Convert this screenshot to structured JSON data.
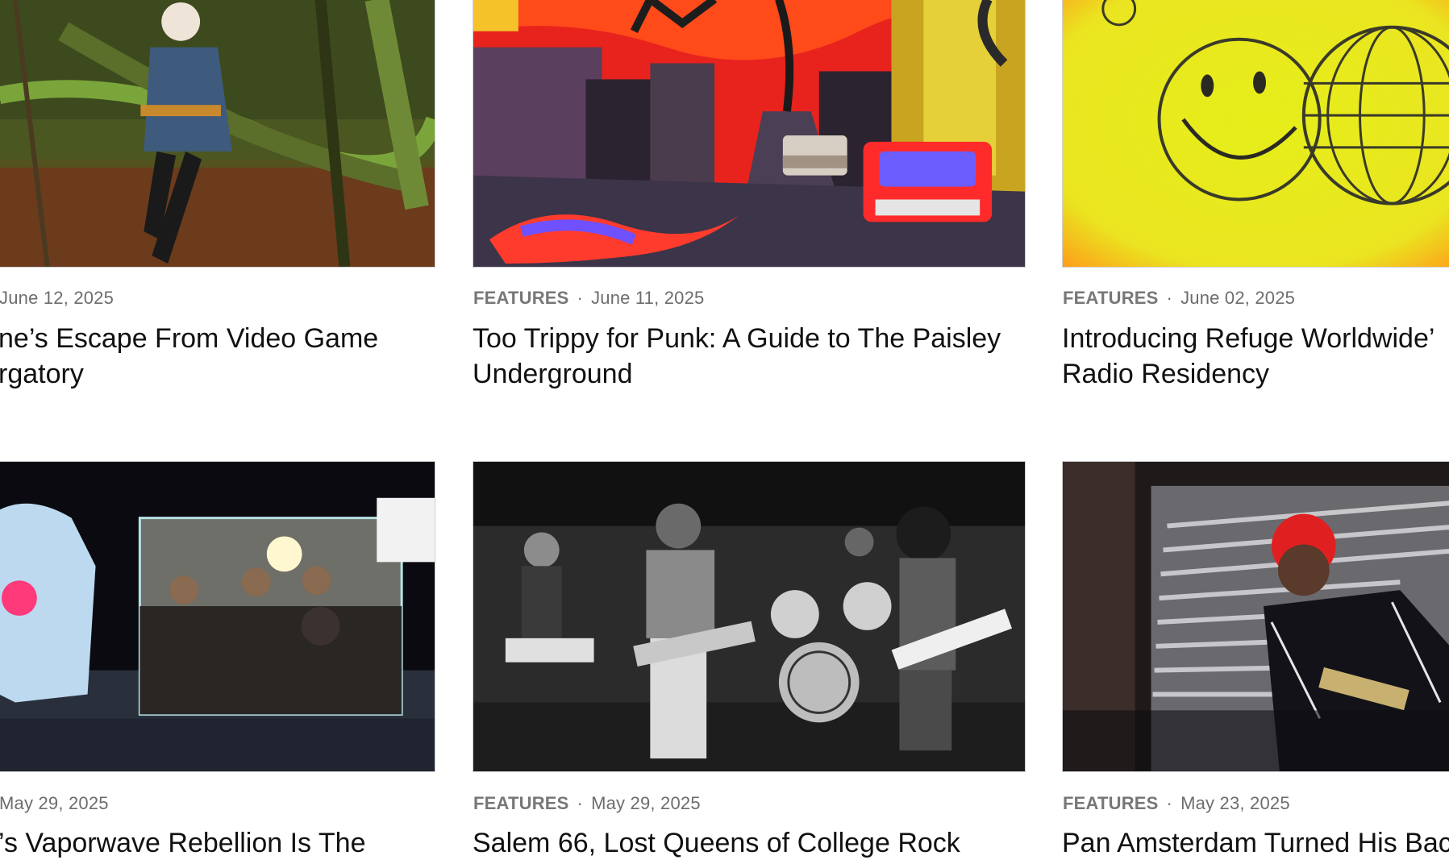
{
  "articles": [
    {
      "category": "",
      "date": "June 12, 2025",
      "title": "ne’s Escape From Video Game\nrgatory",
      "image_icon": "forest-portrait-photo"
    },
    {
      "category": "FEATURES",
      "date": "June 11, 2025",
      "title": "Too Trippy for Punk: A Guide to The Paisley\nUnderground",
      "image_icon": "psychedelic-street-illustration"
    },
    {
      "category": "FEATURES",
      "date": "June 02, 2025",
      "title": "Introducing Refuge Worldwide’\nRadio Residency",
      "image_icon": "smiley-globe-illustration"
    },
    {
      "category": "",
      "date": "May 29, 2025",
      "title": "’s Vaporwave Rebellion Is The",
      "image_icon": "vaporwave-collage-photo"
    },
    {
      "category": "FEATURES",
      "date": "May 29, 2025",
      "title": "Salem 66, Lost Queens of College Rock",
      "image_icon": "band-live-photo"
    },
    {
      "category": "FEATURES",
      "date": "May 23, 2025",
      "title": "Pan Amsterdam Turned His Bac",
      "image_icon": "trumpet-player-portrait-photo"
    }
  ],
  "colors": {
    "meta_text": "#6d6d6d",
    "title_text": "#111111",
    "background": "#ffffff"
  }
}
